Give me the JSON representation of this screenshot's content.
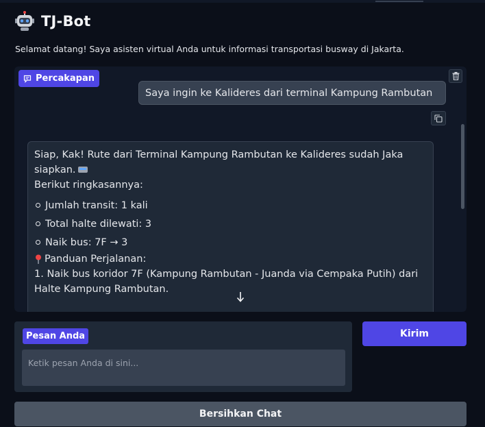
{
  "app": {
    "title": "TJ-Bot",
    "logo_icon": "robot-icon",
    "subtitle": "Selamat datang! Saya asisten virtual Anda untuk informasi transportasi busway di Jakarta."
  },
  "chat": {
    "label": "Percakapan",
    "label_icon": "chat-bubble-icon",
    "messages": [
      {
        "role": "user",
        "text": "Saya ingin ke Kalideres dari terminal Kampung Rambutan"
      },
      {
        "role": "bot",
        "intro": "Siap, Kak! Rute dari Terminal Kampung Rambutan ke Kalideres sudah Jaka siapkan.",
        "intro_icon": "bus-emoji",
        "summary_title": "Berikut ringkasannya:",
        "summary": [
          "Jumlah transit: 1 kali",
          "Total halte dilewati: 3",
          "Naik bus: 7F → 3"
        ],
        "guide_title": "Panduan Perjalanan:",
        "guide_icon": "pin-icon",
        "steps": [
          "1. Naik bus koridor 7F (Kampung Rambutan - Juanda via Cempaka Putih) dari Halte Kampung Rambutan."
        ]
      }
    ]
  },
  "input": {
    "label": "Pesan Anda",
    "placeholder": "Ketik pesan Anda di sini..."
  },
  "buttons": {
    "send": "Kirim",
    "clear": "Bersihkan Chat"
  },
  "colors": {
    "accent": "#4f46e5",
    "background": "#0b0f19",
    "panel": "#111827"
  }
}
